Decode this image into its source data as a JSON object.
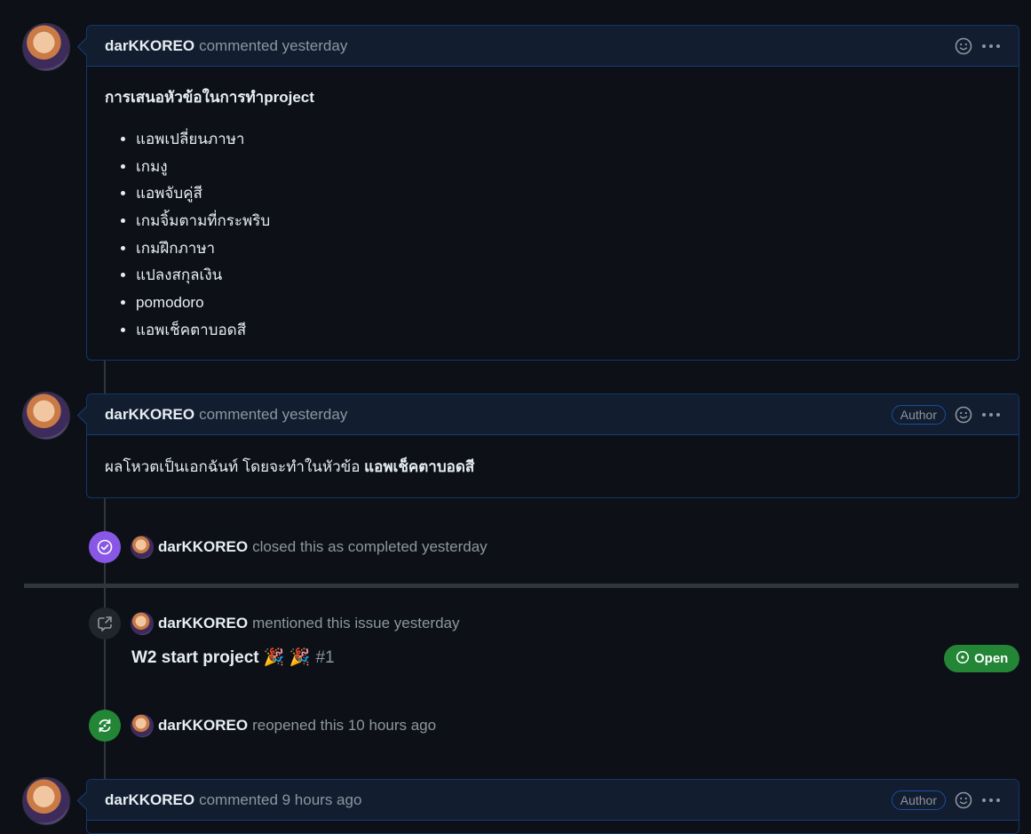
{
  "comments": [
    {
      "author": "darKKOREO",
      "action": "commented yesterday",
      "title": "การเสนอหัวข้อในการทำproject",
      "items": [
        "แอพเปลี่ยนภาษา",
        "เกมงู",
        "แอพจับคู่สี",
        "เกมจิ้มตามที่กระพริบ",
        "เกมฝึกภาษา",
        "แปลงสกุลเงิน",
        "pomodoro",
        "แอพเช็คตาบอดสี"
      ]
    },
    {
      "author": "darKKOREO",
      "action": "commented yesterday",
      "badge": "Author",
      "body_text": "ผลโหวตเป็นเอกฉันท์ โดยจะทำในหัวข้อ ",
      "body_bold": "แอพเช็คตาบอดสี"
    },
    {
      "author": "darKKOREO",
      "action": "commented 9 hours ago",
      "badge": "Author"
    }
  ],
  "events": {
    "closed": {
      "actor": "darKKOREO",
      "text": "closed this as completed yesterday",
      "color": "#8957e5"
    },
    "mentioned": {
      "actor": "darKKOREO",
      "text": "mentioned this issue yesterday",
      "ref_title": "W2 start project 🎉 🎉",
      "ref_number": "#1",
      "status": "Open",
      "status_color": "#238636"
    },
    "reopened": {
      "actor": "darKKOREO",
      "text": "reopened this 10 hours ago",
      "color": "#238636"
    }
  },
  "icons": [
    "smiley-icon",
    "kebab-icon",
    "check-circle-icon",
    "cross-reference-icon",
    "reopen-icon",
    "issue-open-icon"
  ]
}
